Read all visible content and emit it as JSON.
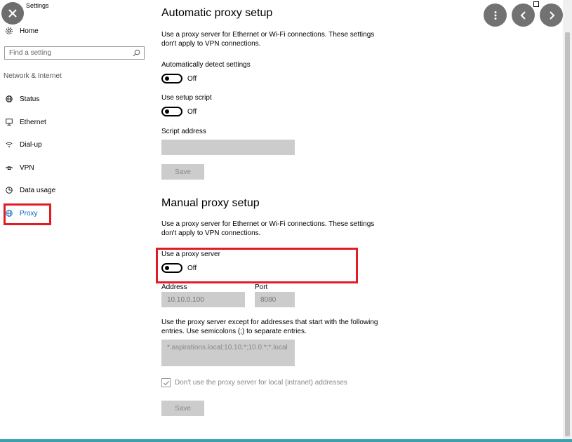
{
  "app": {
    "title": "Settings"
  },
  "sidebar": {
    "home_label": "Home",
    "search_placeholder": "Find a setting",
    "section_label": "Network & Internet",
    "items": [
      {
        "label": "Status",
        "icon": "globe-monitor-icon"
      },
      {
        "label": "Ethernet",
        "icon": "ethernet-icon"
      },
      {
        "label": "Dial-up",
        "icon": "dialup-icon"
      },
      {
        "label": "VPN",
        "icon": "vpn-icon"
      },
      {
        "label": "Data usage",
        "icon": "data-usage-icon"
      },
      {
        "label": "Proxy",
        "icon": "globe-icon",
        "active": true
      }
    ]
  },
  "automatic": {
    "title": "Automatic proxy setup",
    "description": "Use a proxy server for Ethernet or Wi-Fi connections. These settings don't apply to VPN connections.",
    "detect_label": "Automatically detect settings",
    "detect_state": "Off",
    "script_label": "Use setup script",
    "script_state": "Off",
    "script_address_label": "Script address",
    "script_address_value": "",
    "save_label": "Save"
  },
  "manual": {
    "title": "Manual proxy setup",
    "description": "Use a proxy server for Ethernet or Wi-Fi connections. These settings don't apply to VPN connections.",
    "use_proxy_label": "Use a proxy server",
    "use_proxy_state": "Off",
    "address_label": "Address",
    "address_value": "10.10.0.100",
    "port_label": "Port",
    "port_value": "8080",
    "exceptions_description": "Use the proxy server except for addresses that start with the following entries. Use semicolons (;) to separate entries.",
    "exceptions_value": "*.aspirations.local;10.10.*;10.0.*;*.local",
    "local_checkbox_label": "Don't use the proxy server for local (intranet) addresses",
    "local_checkbox_checked": true,
    "save_label": "Save"
  },
  "colors": {
    "accent": "#0067c0",
    "highlight": "#e21c25",
    "disabled_fill": "#cccccc"
  }
}
